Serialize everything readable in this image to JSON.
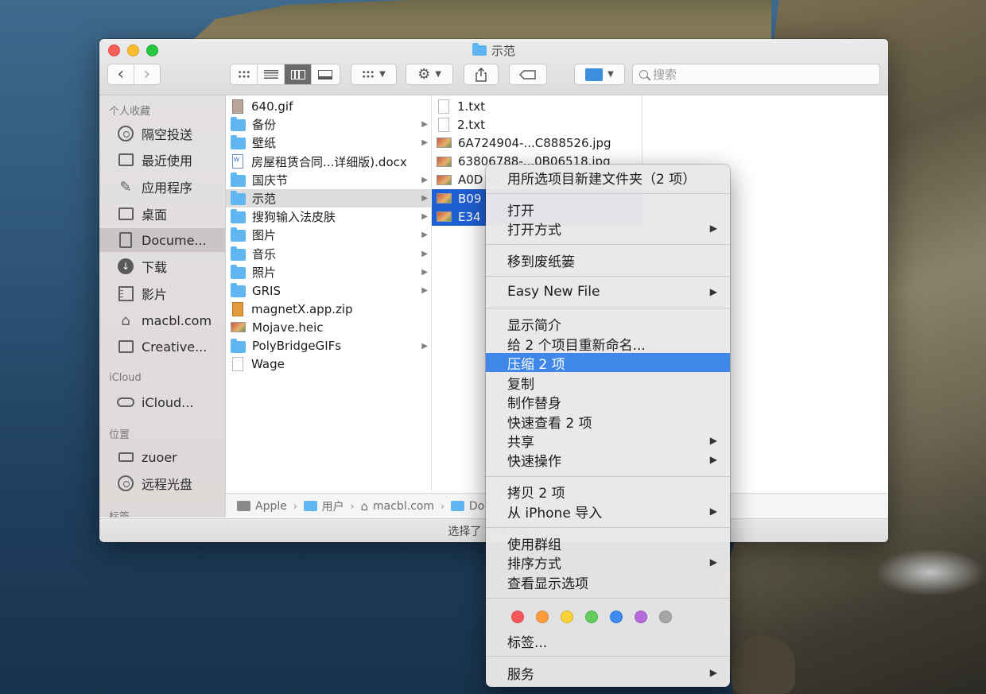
{
  "window": {
    "title": "示范"
  },
  "toolbar": {
    "search_placeholder": "搜索",
    "back_label": "‹",
    "forward_label": "›"
  },
  "sidebar": {
    "sections": [
      {
        "title": "个人收藏"
      },
      {
        "title": "iCloud"
      },
      {
        "title": "位置"
      },
      {
        "title": "标签"
      }
    ],
    "favorites": [
      {
        "label": "隔空投送",
        "icon": "airdrop-icon"
      },
      {
        "label": "最近使用",
        "icon": "recents-icon"
      },
      {
        "label": "应用程序",
        "icon": "applications-icon"
      },
      {
        "label": "桌面",
        "icon": "desktop-icon"
      },
      {
        "label": "Docume...",
        "icon": "documents-icon",
        "selected": true
      },
      {
        "label": "下载",
        "icon": "downloads-icon"
      },
      {
        "label": "影片",
        "icon": "movies-icon"
      },
      {
        "label": "macbl.com",
        "icon": "home-icon"
      },
      {
        "label": "Creative...",
        "icon": "folder-icon"
      }
    ],
    "icloud": [
      {
        "label": "iCloud...",
        "icon": "cloud-icon"
      }
    ],
    "locations": [
      {
        "label": "zuoer",
        "icon": "laptop-icon"
      },
      {
        "label": "远程光盘",
        "icon": "disc-icon"
      }
    ]
  },
  "column1": [
    {
      "name": "640.gif",
      "type": "gif",
      "arrow": false
    },
    {
      "name": "备份",
      "type": "folder",
      "arrow": true
    },
    {
      "name": "壁纸",
      "type": "folder",
      "arrow": true
    },
    {
      "name": "房屋租赁合同...详细版).docx",
      "type": "word",
      "arrow": false
    },
    {
      "name": "国庆节",
      "type": "folder",
      "arrow": true
    },
    {
      "name": "示范",
      "type": "folder",
      "arrow": true,
      "highlight": true
    },
    {
      "name": "搜狗输入法皮肤",
      "type": "folder",
      "arrow": true
    },
    {
      "name": "图片",
      "type": "folder",
      "arrow": true
    },
    {
      "name": "音乐",
      "type": "folder",
      "arrow": true
    },
    {
      "name": "照片",
      "type": "folder",
      "arrow": true
    },
    {
      "name": "GRIS",
      "type": "folder",
      "arrow": true
    },
    {
      "name": "magnetX.app.zip",
      "type": "zip",
      "arrow": false
    },
    {
      "name": "Mojave.heic",
      "type": "img",
      "arrow": false
    },
    {
      "name": "PolyBridgeGIFs",
      "type": "folder",
      "arrow": true
    },
    {
      "name": "Wage",
      "type": "doc",
      "arrow": false
    }
  ],
  "column2": [
    {
      "name": "1.txt",
      "type": "doc"
    },
    {
      "name": "2.txt",
      "type": "doc"
    },
    {
      "name": "6A724904-...C888526.jpg",
      "type": "img"
    },
    {
      "name": "63806788-...0B06518.jpg",
      "type": "img"
    },
    {
      "name": "A0D",
      "type": "img"
    },
    {
      "name": "B09",
      "type": "img",
      "selected": true
    },
    {
      "name": "E34",
      "type": "img",
      "selected": true
    }
  ],
  "pathbar": [
    {
      "label": "Apple"
    },
    {
      "label": "用户"
    },
    {
      "label": "macbl.com"
    },
    {
      "label": "Do"
    }
  ],
  "statusbar": {
    "text": "选择了 2 项（共 7"
  },
  "context_menu": {
    "items": [
      {
        "label": "用所选项目新建文件夹（2 项）",
        "submenu": false
      },
      {
        "label": "打开",
        "submenu": false
      },
      {
        "label": "打开方式",
        "submenu": true
      },
      {
        "label": "移到废纸篓",
        "submenu": false
      },
      {
        "label": "Easy New File",
        "submenu": true
      },
      {
        "label": "显示简介",
        "submenu": false
      },
      {
        "label": "给 2 个项目重新命名...",
        "submenu": false
      },
      {
        "label": "压缩 2 项",
        "submenu": false,
        "active": true
      },
      {
        "label": "复制",
        "submenu": false
      },
      {
        "label": "制作替身",
        "submenu": false
      },
      {
        "label": "快速查看 2 项",
        "submenu": false
      },
      {
        "label": "共享",
        "submenu": true
      },
      {
        "label": "快速操作",
        "submenu": true
      },
      {
        "label": "拷贝 2 项",
        "submenu": false
      },
      {
        "label": "从 iPhone 导入",
        "submenu": true
      },
      {
        "label": "使用群组",
        "submenu": false
      },
      {
        "label": "排序方式",
        "submenu": true
      },
      {
        "label": "查看显示选项",
        "submenu": false
      },
      {
        "label": "标签...",
        "submenu": false
      },
      {
        "label": "服务",
        "submenu": true
      }
    ],
    "submenu_arrow": "▶",
    "tag_colors": [
      "#f8595d",
      "#fd9d3c",
      "#fdd33a",
      "#5fcf5a",
      "#3d8df5",
      "#b66bdd",
      "#a5a5a5"
    ]
  }
}
